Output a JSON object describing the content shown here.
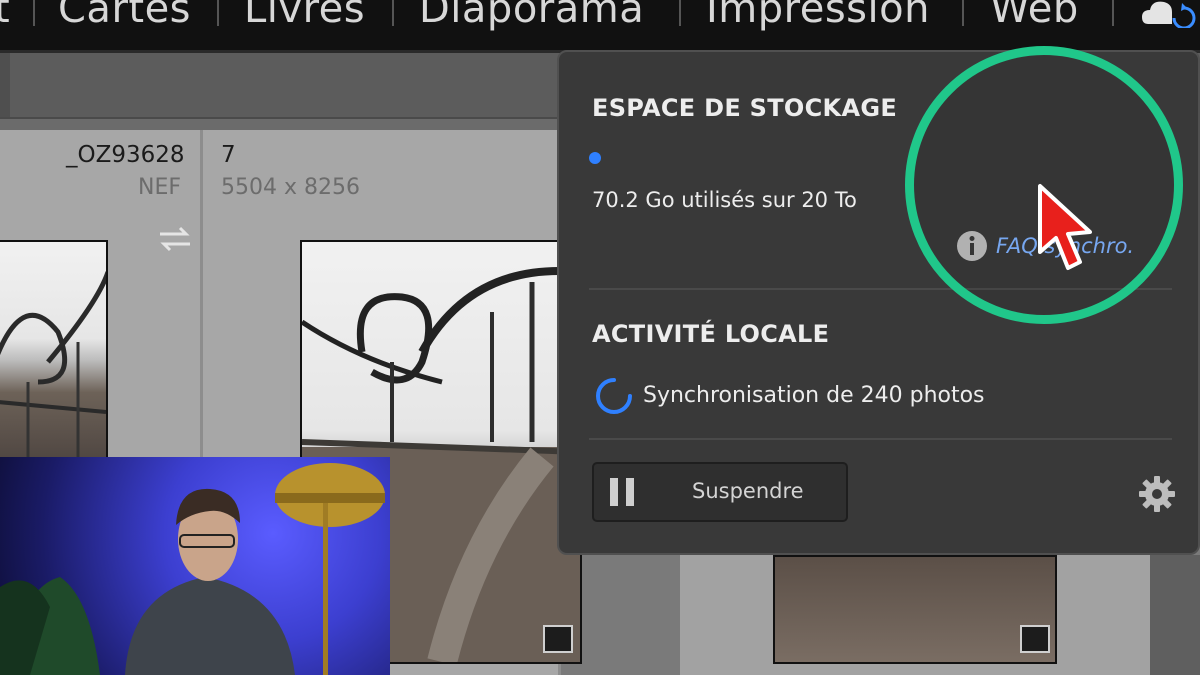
{
  "topbar": {
    "modules": [
      "t",
      "Cartes",
      "Livres",
      "Diaporama",
      "Impression",
      "Web"
    ],
    "cloud_icon": "cloud-sync-icon"
  },
  "grid": {
    "cells": [
      {
        "filename": "_OZ93628",
        "format": "NEF"
      },
      {
        "index": "7",
        "dimensions": "5504 x 8256"
      }
    ],
    "swap_icon": "swap-arrows-icon"
  },
  "popup": {
    "storage": {
      "title": "ESPACE DE STOCKAGE",
      "usage": "70.2 Go utilisés sur 20 To",
      "faq_link": "FAQ synchro.",
      "dot_color": "#2f80ff"
    },
    "local": {
      "title": "ACTIVITÉ LOCALE",
      "sync_status": "Synchronisation de 240 photos"
    },
    "pause_button": "Suspendre",
    "settings_icon": "gear-icon"
  },
  "overlay": {
    "highlight_color": "#20c78a",
    "cursor_color": "#e8201c"
  }
}
